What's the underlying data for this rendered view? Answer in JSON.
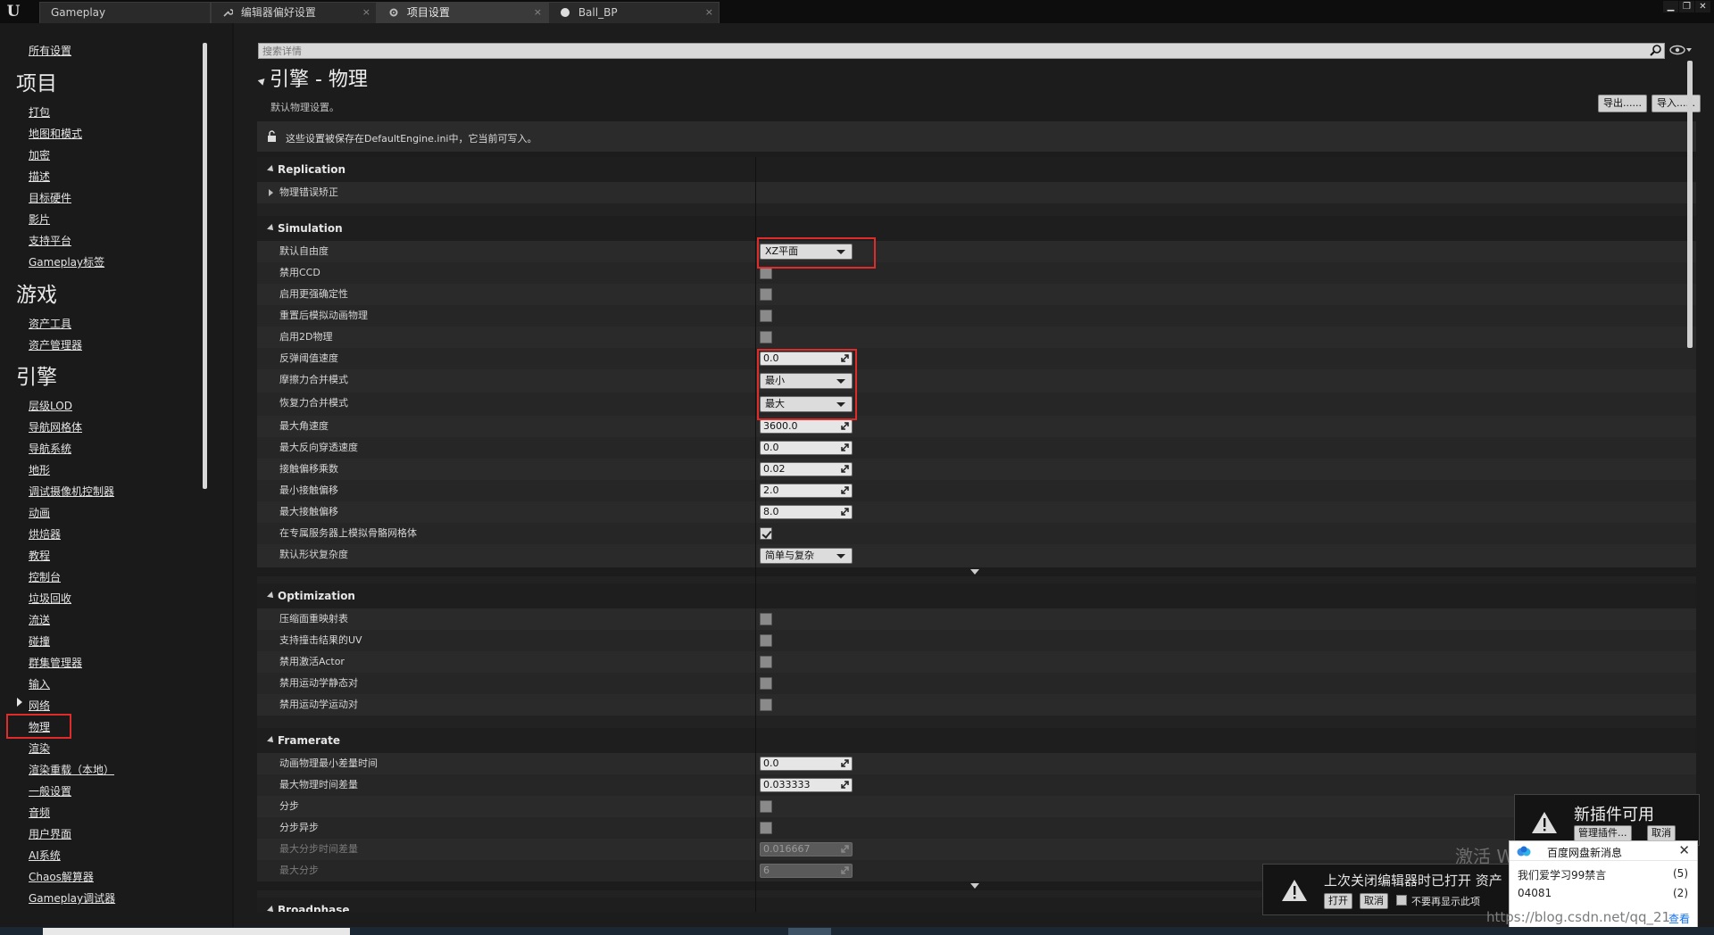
{
  "tabs": [
    {
      "label": "Gameplay",
      "close": ""
    },
    {
      "label": "编辑器偏好设置",
      "close": "×"
    },
    {
      "label": "项目设置",
      "close": "×"
    },
    {
      "label": "Ball_BP",
      "close": "×"
    }
  ],
  "window_controls": {
    "minimize": "▁",
    "restore": "❐",
    "close": "✕"
  },
  "sidebar": {
    "all_settings": "所有设置",
    "sections": [
      {
        "heading": "项目",
        "items": [
          "打包",
          "地图和模式",
          "加密",
          "描述",
          "目标硬件",
          "影片",
          "支持平台",
          "Gameplay标签"
        ]
      },
      {
        "heading": "游戏",
        "items": [
          "资产工具",
          "资产管理器"
        ]
      },
      {
        "heading": "引擎",
        "items": [
          "层级LOD",
          "导航网格体",
          "导航系统",
          "地形",
          "调试摄像机控制器",
          "动画",
          "烘焙器",
          "教程",
          "控制台",
          "垃圾回收",
          "流送",
          "碰撞",
          "群集管理器",
          "输入",
          "网络",
          "物理",
          "渲染",
          "渲染重载（本地）",
          "一般设置",
          "音频",
          "用户界面",
          "AI系统",
          "Chaos解算器",
          "Gameplay调试器"
        ]
      }
    ],
    "selected": "物理"
  },
  "search": {
    "placeholder": "搜索详情"
  },
  "header": {
    "title": "引擎 - 物理",
    "subtitle": "默认物理设置。",
    "export_label": "导出......",
    "import_label": "导入......"
  },
  "notice": "这些设置被保存在DefaultEngine.ini中，它当前可写入。",
  "categories": {
    "replication": {
      "name": "Replication",
      "rows": [
        {
          "label": "物理错误矫正"
        }
      ]
    },
    "simulation": {
      "name": "Simulation",
      "rows": [
        {
          "label": "默认自由度",
          "type": "dropdown",
          "value": "XZ平面"
        },
        {
          "label": "禁用CCD",
          "type": "checkbox",
          "checked": false
        },
        {
          "label": "启用更强确定性",
          "type": "checkbox",
          "checked": false
        },
        {
          "label": "重置后模拟动画物理",
          "type": "checkbox",
          "checked": false
        },
        {
          "label": "启用2D物理",
          "type": "checkbox",
          "checked": false
        },
        {
          "label": "反弹阈值速度",
          "type": "number",
          "value": "0.0"
        },
        {
          "label": "摩擦力合并模式",
          "type": "dropdown",
          "value": "最小"
        },
        {
          "label": "恢复力合并模式",
          "type": "dropdown",
          "value": "最大"
        },
        {
          "label": "最大角速度",
          "type": "number",
          "value": "3600.0"
        },
        {
          "label": "最大反向穿透速度",
          "type": "number",
          "value": "0.0"
        },
        {
          "label": "接触偏移乘数",
          "type": "number",
          "value": "0.02"
        },
        {
          "label": "最小接触偏移",
          "type": "number",
          "value": "2.0"
        },
        {
          "label": "最大接触偏移",
          "type": "number",
          "value": "8.0"
        },
        {
          "label": "在专属服务器上模拟骨骼网格体",
          "type": "checkbox",
          "checked": true
        },
        {
          "label": "默认形状复杂度",
          "type": "dropdown",
          "value": "简单与复杂"
        }
      ]
    },
    "optimization": {
      "name": "Optimization",
      "rows": [
        {
          "label": "压缩面重映射表",
          "type": "checkbox",
          "checked": false
        },
        {
          "label": "支持撞击结果的UV",
          "type": "checkbox",
          "checked": false
        },
        {
          "label": "禁用激活Actor",
          "type": "checkbox",
          "checked": false
        },
        {
          "label": "禁用运动学静态对",
          "type": "checkbox",
          "checked": false
        },
        {
          "label": "禁用运动学运动对",
          "type": "checkbox",
          "checked": false
        }
      ]
    },
    "framerate": {
      "name": "Framerate",
      "rows": [
        {
          "label": "动画物理最小差量时间",
          "type": "number",
          "value": "0.0"
        },
        {
          "label": "最大物理时间差量",
          "type": "number",
          "value": "0.033333"
        },
        {
          "label": "分步",
          "type": "checkbox",
          "checked": false
        },
        {
          "label": "分步异步",
          "type": "checkbox",
          "checked": false
        },
        {
          "label": "最大分步时间差量",
          "type": "number",
          "value": "0.016667",
          "disabled": true
        },
        {
          "label": "最大分步",
          "type": "number",
          "value": "6",
          "disabled": true
        }
      ]
    },
    "broadphase": {
      "name": "Broadphase"
    }
  },
  "plugin_toast": {
    "title": "新插件可用",
    "manage": "管理插件...",
    "cancel": "取消"
  },
  "restore_toast": {
    "text": "上次关闭编辑器时已打开 资产",
    "open": "打开",
    "cancel": "取消",
    "dont_show": "不要再显示此项"
  },
  "watermarks": {
    "activate": "激活 Wi",
    "url": "https://blog.csdn.net/qq_21"
  },
  "baidu": {
    "title": "百度网盘新消息",
    "items": [
      {
        "text": "我们爱学习99禁言",
        "count": "(5)"
      },
      {
        "text": "04081",
        "count": "(2)"
      }
    ],
    "view": "查看",
    "close": "✕"
  },
  "colors": {
    "highlight": "#e02b2b",
    "panel": "#222222",
    "sidebar": "#1a1a1a"
  }
}
